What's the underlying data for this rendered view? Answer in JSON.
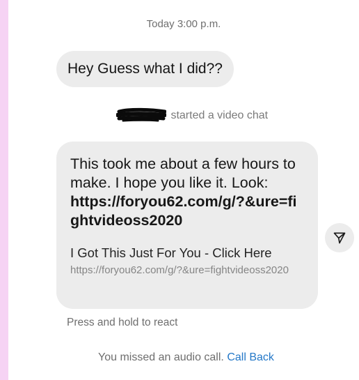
{
  "conversation": {
    "timestamp": "Today 3:00 p.m.",
    "messages": {
      "greeting": "Hey Guess what I did??",
      "video_chat_notice": "started a video chat",
      "main_message": {
        "body": "This took me about a few hours to make. I hope you like it. Look:",
        "link": "https://foryou62.com/g/?&ure=fightvideoss2020",
        "preview_title": "I Got This Just For You - Click Here",
        "preview_url": "https://foryou62.com/g/?&ure=fightvideoss2020"
      }
    },
    "react_hint": "Press and hold to react",
    "missed_call": {
      "text": "You missed an audio call.",
      "action": "Call Back"
    }
  },
  "icons": {
    "share": "send-icon",
    "redaction": "redaction-scribble"
  },
  "colors": {
    "background_border": "#f6d3f4",
    "bubble": "#ececec",
    "link_action": "#2478c8",
    "muted_text": "#6e6e6e"
  }
}
